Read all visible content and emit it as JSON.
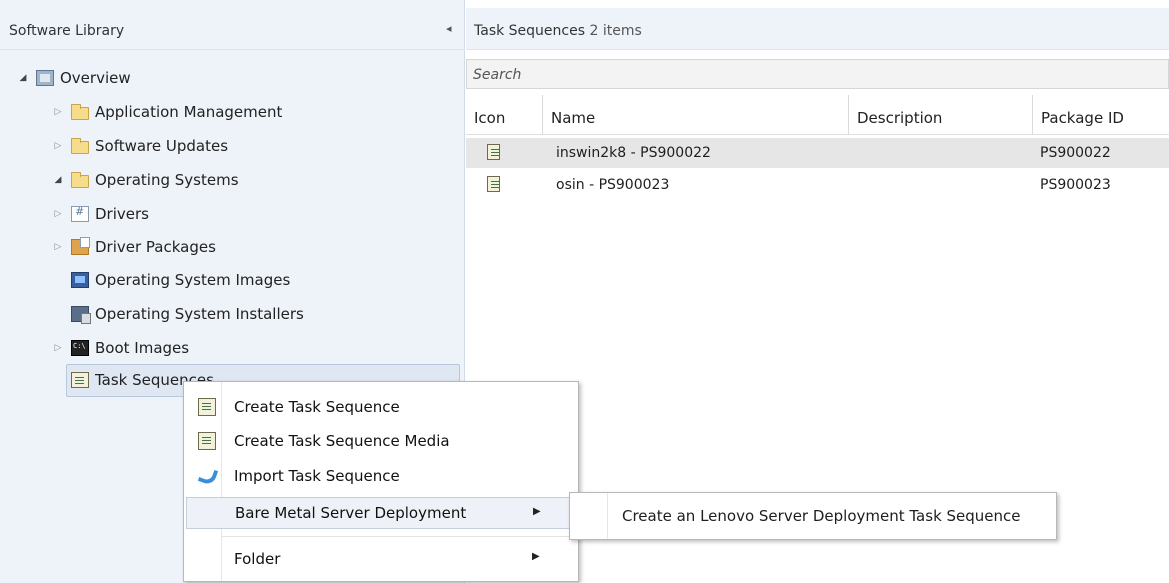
{
  "left_pane": {
    "title": "Software Library",
    "collapse_glyph": "◂",
    "tree": {
      "overview": "Overview",
      "application_management": "Application Management",
      "software_updates": "Software Updates",
      "operating_systems": "Operating Systems",
      "drivers": "Drivers",
      "driver_packages": "Driver Packages",
      "os_images": "Operating System Images",
      "os_installers": "Operating System Installers",
      "boot_images": "Boot Images",
      "task_sequences": "Task Sequences"
    }
  },
  "right_pane": {
    "title": "Task Sequences",
    "item_count": "2 items",
    "search": {
      "placeholder": "Search",
      "value": ""
    },
    "columns": [
      "Icon",
      "Name",
      "Description",
      "Package ID"
    ],
    "rows": [
      {
        "name": "inswin2k8 - PS900022",
        "description": "",
        "package_id": "PS900022",
        "selected": true
      },
      {
        "name": "osin - PS900023",
        "description": "",
        "package_id": "PS900023",
        "selected": false
      }
    ]
  },
  "context_menu": {
    "items": {
      "create_ts": "Create Task Sequence",
      "create_ts_media": "Create Task Sequence Media",
      "import_ts": "Import Task Sequence",
      "bare_metal": "Bare Metal Server Deployment",
      "folder": "Folder"
    },
    "submenu_arrow": "▶",
    "submenu": {
      "create_lenovo": "Create an Lenovo Server Deployment Task Sequence"
    }
  },
  "icons": {
    "expander_closed": "▷",
    "expander_open": "◢"
  },
  "colors": {
    "pane_background": "#eef3fa",
    "selection": "#dfe7f2",
    "row_selection": "#e6e6e6",
    "accent": "#3a8fd8"
  }
}
